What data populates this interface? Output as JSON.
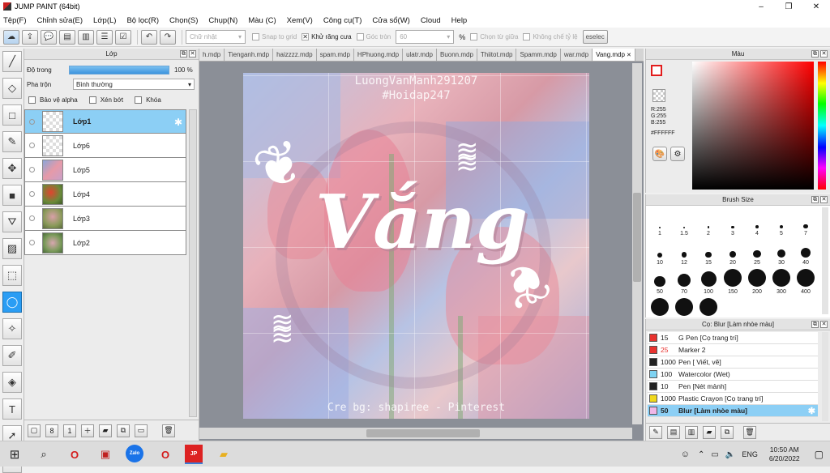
{
  "window": {
    "title": "JUMP PAINT (64bit)",
    "minimize_icon": "–",
    "maximize_icon": "❐",
    "close_icon": "✕"
  },
  "menu": [
    "Tệp(F)",
    "Chỉnh sửa(E)",
    "Lớp(L)",
    "Bộ lọc(R)",
    "Chọn(S)",
    "Chụp(N)",
    "Màu (C)",
    "Xem(V)",
    "Công cụ(T)",
    "Cửa sổ(W)",
    "Cloud",
    "Help"
  ],
  "toolbar": {
    "shape_select": "Chữ nhật",
    "snap_grid": "Snap to grid",
    "antialias": "Khử răng cưa",
    "corner_round": "Góc tròn",
    "corner_value": "60",
    "percent": "%",
    "select_center": "Chọn từ giữa",
    "fixed_ratio": "Không chế tỷ lệ",
    "deselect": "eselec"
  },
  "layer_panel": {
    "title": "Lớp",
    "opacity_label": "Độ trong",
    "opacity_value": "100 %",
    "opacity": 1.0,
    "blend_label": "Pha trộn",
    "blend_value": "Bình thường",
    "protect_alpha": "Bảo vệ alpha",
    "clipping": "Xén bớt",
    "lock": "Khóa",
    "layers": [
      "Lớp1",
      "Lớp6",
      "Lớp5",
      "Lớp4",
      "Lớp3",
      "Lớp2"
    ]
  },
  "tabs": [
    "h.mdp",
    "Tienganh.mdp",
    "haizzzz.mdp",
    "spam.mdp",
    "HPhuong.mdp",
    "ulatr.mdp",
    "Buonn.mdp",
    "Thiitot.mdp",
    "Spamm.mdp",
    "war.mdp",
    "Vang.mdp"
  ],
  "artwork": {
    "credit_top_1": "LuongVanManh291207",
    "credit_top_2": "#Hoidap247",
    "main_word": "Vắng",
    "credit_bottom": "Cre bg: shapiree - Pinterest"
  },
  "color_panel": {
    "title": "Màu",
    "r": "R:255",
    "g": "G:255",
    "b": "B:255",
    "hex": "#FFFFFF",
    "fg_color": "#e21c1c"
  },
  "brush_panel": {
    "title": "Brush Size",
    "sizes": [
      "1",
      "1.5",
      "2",
      "3",
      "4",
      "5",
      "7",
      "10",
      "12",
      "15",
      "20",
      "25",
      "30",
      "40",
      "50",
      "70",
      "100",
      "150",
      "200",
      "300",
      "400",
      "",
      "",
      ""
    ]
  },
  "subtool_panel": {
    "title": "Cọ: Blur [Làm nhòe màu]",
    "items": [
      {
        "num": "15",
        "name": "G Pen [Cọ trang trí]",
        "color": "#e8332f"
      },
      {
        "num": "25",
        "name": "Marker 2",
        "color": "#e8332f",
        "num_color": "#e8332f"
      },
      {
        "num": "1000",
        "name": "Pen [ Viết, vẽ]",
        "color": "#222222"
      },
      {
        "num": "100",
        "name": "Watercolor (Wet)",
        "color": "#7fd3f2"
      },
      {
        "num": "10",
        "name": "Pen [Nét mảnh]",
        "color": "#222222"
      },
      {
        "num": "1000",
        "name": "Plastic Crayon [Cọ trang trí]",
        "color": "#f0d81c"
      },
      {
        "num": "50",
        "name": "Blur [Làm nhòe màu]",
        "color": "#f0b7e8"
      }
    ]
  },
  "taskbar": {
    "time": "10:50 AM",
    "date": "6/20/2022",
    "lang": "ENG",
    "zalo": "Zalo"
  }
}
